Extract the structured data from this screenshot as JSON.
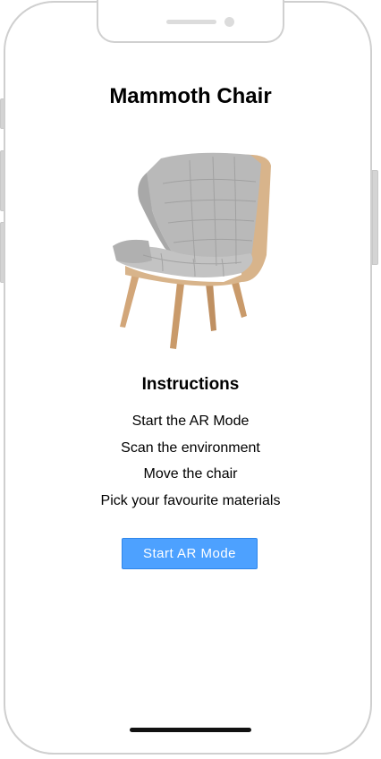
{
  "page": {
    "title": "Mammoth Chair",
    "image_alt": "Mammoth Chair",
    "instructions_heading": "Instructions",
    "instructions": [
      "Start the AR Mode",
      "Scan the environment",
      "Move the chair",
      "Pick your favourite materials"
    ],
    "cta_label": "Start AR Mode"
  },
  "colors": {
    "accent": "#4da1ff",
    "accent_border": "#2f86ea",
    "upholstery": "#b9b9b9",
    "wood": "#d2a679"
  }
}
